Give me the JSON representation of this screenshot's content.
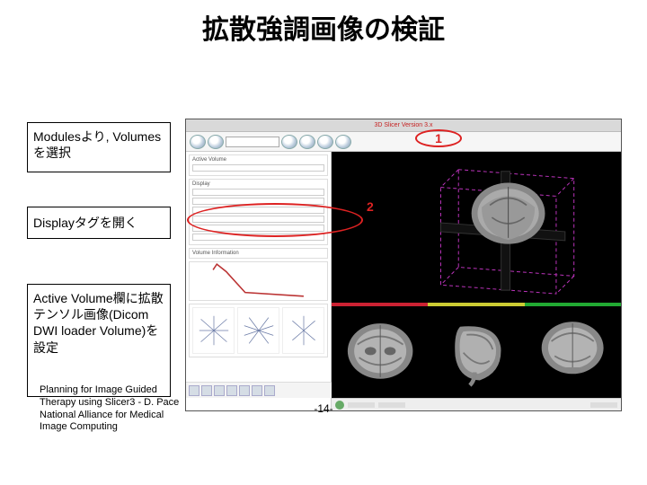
{
  "title": "拡散強調画像の検証",
  "callouts": {
    "c1": "Modulesより, Volumesを選択",
    "c2": "Displayタグを開く",
    "c3": "Active Volume欄に拡散テンソル画像(Dicom DWI loader Volume)を設定"
  },
  "annotations": {
    "n1": "1",
    "n2": "2"
  },
  "credit_line1": "Planning for Image Guided",
  "credit_line2": "Therapy using Slicer3 - D. Pace",
  "credit_line3": "National Alliance for Medical",
  "credit_line4": "Image Computing",
  "page_number": "-14-",
  "screenshot": {
    "titlebar": "3D Slicer Version 3.x",
    "panel": {
      "active_volume_label": "Active Volume",
      "display_label": "Display",
      "info_label": "Volume Information"
    }
  }
}
